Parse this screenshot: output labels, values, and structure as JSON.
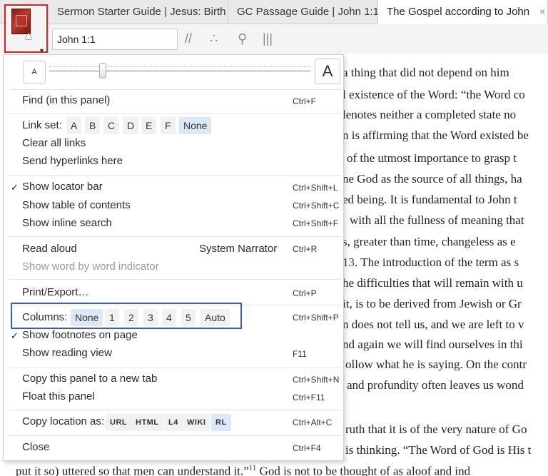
{
  "tabs": [
    {
      "label": "Sermon Starter Guide | Jesus: Birth"
    },
    {
      "label": "GC Passage Guide | John 1:1"
    },
    {
      "label": "The Gospel according to John",
      "close": "×"
    }
  ],
  "toolbar": {
    "reference": "John 1:1",
    "icons": [
      "book-icon",
      "parallel-icon",
      "visual-filters-icon",
      "search-icon",
      "columns-icon"
    ]
  },
  "document": {
    "lines": [
      {
        "text": "a thing that did not depend on him"
      },
      {
        "text": "l existence of the Word: “the Word co"
      },
      {
        "text": "lenotes neither a completed state no"
      },
      {
        "text": "n is affirming that the Word existed be"
      },
      {
        "text": "of the utmost importance to grasp t"
      },
      {
        "text": "ne God as the source of all things, ha"
      },
      {
        "text": "ed being. It is fundamental to John t"
      },
      {
        "text": "with all the fullness of meaning that"
      },
      {
        "text": "s, greater than time, changeless as e"
      },
      {
        "link": "13",
        "text": ". The introduction of the term as s"
      },
      {
        "text": "he difficulties that will remain with u"
      },
      {
        "text": "it, is to be derived from Jewish or Gr"
      },
      {
        "text": "n does not tell us, and we are left to v"
      },
      {
        "text": "nd again we will find ourselves in thi"
      },
      {
        "text": "ollow what he is saying. On the contr"
      },
      {
        "text": "and profundity often leaves us wond"
      },
      {
        "text": "ruth that it is of the very nature of Go"
      },
      {
        "text": "is thinking. “The Word of God is His t"
      },
      {
        "text": "put it so) uttered so that men can understand it.”",
        "sup": "11",
        "tail": " God is not to be thought of as aloof and ind"
      }
    ]
  },
  "menu": {
    "font_size": {
      "small": "A",
      "large": "A",
      "level": 0.2
    },
    "items": {
      "find": {
        "label": "Find (in this panel)",
        "shortcut": "Ctrl+F"
      },
      "link_set": {
        "label": "Link set:",
        "options": [
          "A",
          "B",
          "C",
          "D",
          "E",
          "F",
          "None"
        ],
        "selected": "None"
      },
      "clear_links": {
        "label": "Clear all links"
      },
      "send_links": {
        "label": "Send hyperlinks here"
      },
      "locator": {
        "label": "Show locator bar",
        "shortcut": "Ctrl+Shift+L",
        "checked": "✓"
      },
      "toc": {
        "label": "Show table of contents",
        "shortcut": "Ctrl+Shift+C"
      },
      "inline_search": {
        "label": "Show inline search",
        "shortcut": "Ctrl+Shift+F"
      },
      "read_aloud": {
        "label": "Read aloud",
        "voice": "System Narrator",
        "shortcut": "Ctrl+R"
      },
      "word_indicator": {
        "label": "Show word by word indicator"
      },
      "print": {
        "label": "Print/Export…",
        "shortcut": "Ctrl+P"
      },
      "columns": {
        "label": "Columns:",
        "options": [
          "None",
          "1",
          "2",
          "3",
          "4",
          "5",
          "Auto"
        ],
        "selected": "None",
        "shortcut": "Ctrl+Shift+P"
      },
      "footnotes": {
        "label": "Show footnotes on page",
        "checked": "✓"
      },
      "reading_view": {
        "label": "Show reading view",
        "shortcut": "F11"
      },
      "copy_panel": {
        "label": "Copy this panel to a new tab",
        "shortcut": "Ctrl+Shift+N"
      },
      "float_panel": {
        "label": "Float this panel",
        "shortcut": "Ctrl+F11"
      },
      "copy_location": {
        "label": "Copy location as:",
        "options": [
          "URL",
          "HTML",
          "L4",
          "WIKI",
          "RL"
        ],
        "selected": "RL",
        "shortcut": "Ctrl+Alt+C"
      },
      "close": {
        "label": "Close",
        "shortcut": "Ctrl+F4"
      }
    }
  },
  "colors": {
    "highlight_box": "#3e5db0",
    "icon_border": "#dd2222",
    "chip_selected": "#dbe8f7"
  }
}
